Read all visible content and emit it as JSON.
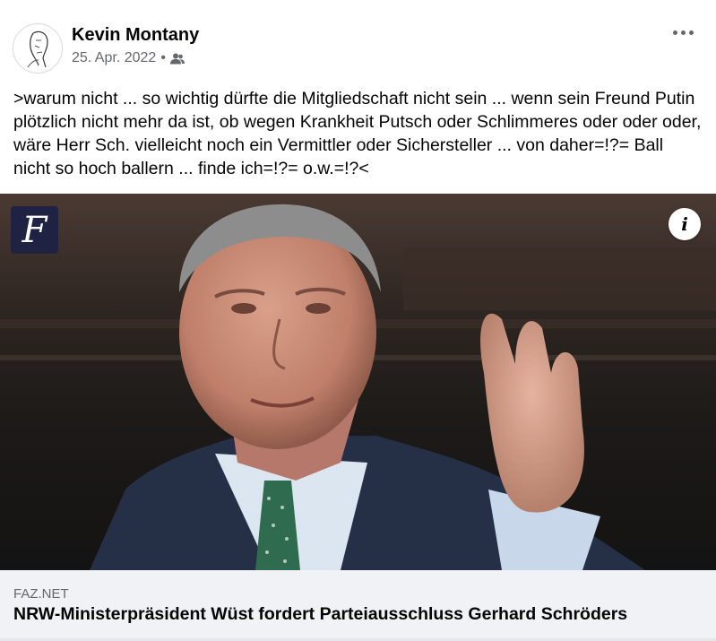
{
  "post": {
    "author": "Kevin Montany",
    "date": "25. Apr. 2022",
    "separator": "•",
    "audience_icon": "friends-icon",
    "more_icon": "more-options-icon",
    "text": ">warum nicht ... so wichtig dürfte die Mitgliedschaft nicht sein ... wenn sein Freund Putin plötzlich nicht mehr da ist, ob wegen Krankheit Putsch oder Schlimmeres oder oder oder, wäre Herr Sch. vielleicht noch ein Vermittler oder Sichersteller ... von daher=!?= Ball nicht so hoch ballern ... finde ich=!?= o.w.=!?<"
  },
  "link": {
    "publisher_logo": "F",
    "info_label": "i",
    "domain": "FAZ.NET",
    "headline": "NRW-Ministerpräsident Wüst fordert Parteiausschluss Gerhard Schröders"
  },
  "colors": {
    "text": "#050505",
    "secondary": "#65676b",
    "card_bg": "#f0f2f5",
    "logo_bg": "#1f2242"
  }
}
